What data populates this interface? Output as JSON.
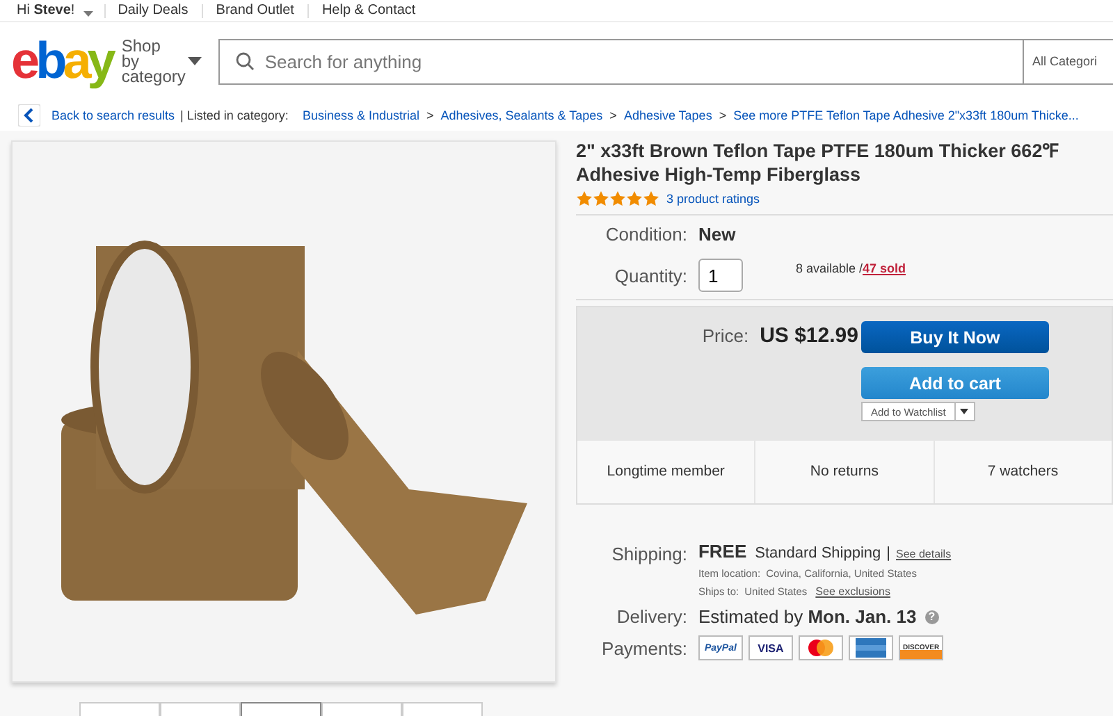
{
  "top_nav": {
    "greeting": "Hi **Steve**!",
    "links": [
      "Daily Deals",
      "Brand Outlet",
      "Help & Contact"
    ]
  },
  "header": {
    "logo": "ebay",
    "shop_by_category": "Shop by category",
    "search": {
      "placeholder": "Search for anything"
    },
    "category_select": "All Categori"
  },
  "breadcrumb": {
    "back": "Back to search results",
    "listed_in": "| Listed in category:",
    "separator": ">",
    "items": [
      "Business & Industrial",
      "Adhesives, Sealants & Tapes",
      "Adhesive Tapes",
      "See more PTFE Teflon Tape Adhesive 2\"x33ft 180um Thicke..."
    ]
  },
  "gallery": {
    "thumbnails": [
      {
        "selected": false
      },
      {
        "selected": false
      },
      {
        "selected": true
      },
      {
        "selected": false
      },
      {
        "selected": false
      }
    ]
  },
  "product": {
    "title": "2\" x33ft Brown Teflon Tape PTFE 180um Thicker 662℉ Adhesive High-Temp Fiberglass",
    "stars": 5,
    "ratings": "3 product ratings",
    "condition": {
      "label": "Condition:",
      "value": "New"
    },
    "quantity": {
      "label": "Quantity:",
      "value": "1",
      "available": "8 available / ",
      "sold": "47 sold"
    },
    "price": {
      "label": "Price:",
      "value": "US $12.99"
    },
    "buttons": [
      {
        "kind": "primary",
        "label": "Buy It Now"
      },
      {
        "kind": "secondary",
        "label": "Add to cart"
      }
    ],
    "watchlist": "Add to Watchlist",
    "features": [
      "Longtime member",
      "No returns",
      "7 watchers"
    ],
    "shipping": {
      "label": "Shipping:",
      "cost": "FREE",
      "method": "Standard Shipping",
      "separator": "|",
      "details_link": "See details",
      "location_label": "Item location:",
      "location": "Covina, California, United States",
      "ships_to_label": "Ships to:",
      "ships_to": "United States",
      "exclusions_link": "See exclusions"
    },
    "delivery": {
      "label": "Delivery:",
      "text": "Estimated by **Mon. Jan. 13**",
      "help": "?"
    },
    "payments": {
      "label": "Payments:",
      "methods": [
        {
          "kind": "paypal",
          "label": "PayPal"
        },
        {
          "kind": "visa",
          "label": "VISA"
        },
        {
          "kind": "mastercard"
        },
        {
          "kind": "amex"
        },
        {
          "kind": "discover",
          "label": "DISCOVER"
        }
      ]
    }
  }
}
